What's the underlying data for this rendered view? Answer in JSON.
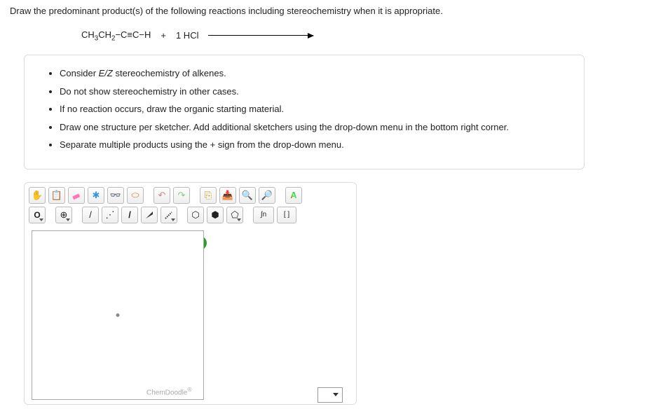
{
  "question": {
    "prompt": "Draw the predominant product(s) of the following reactions including stereochemistry when it is appropriate.",
    "reaction": {
      "reactant_html": "CH<sub>3</sub>CH<sub>2</sub>−C≡C−H",
      "plus": "+",
      "reagent": "1 HCl"
    }
  },
  "hints": [
    "Consider <span class=\"italic\">E/Z</span> stereochemistry of alkenes.",
    "Do not show stereochemistry in other cases.",
    "If no reaction occurs, draw the organic starting material.",
    "Draw one structure per sketcher. Add additional sketchers using the drop-down menu in the bottom right corner.",
    "Separate multiple products using the + sign from the drop-down menu."
  ],
  "sketcher": {
    "help_badge": "?",
    "chemdoodle_label": "ChemDoodle",
    "element_button": "O",
    "charge_button": "⊕",
    "toolbar1": {
      "hand": "✋",
      "clipboard": "📋",
      "eraser": "⌫",
      "center": "✱",
      "glasses": "👓",
      "lasso": "⬭",
      "undo": "↶",
      "redo": "↷",
      "copy": "⎘",
      "paste": "📥",
      "zoom_in": "🔍",
      "zoom_out": "🔎",
      "style": "A"
    },
    "bonds": {
      "single": "/",
      "recess": "⋰",
      "bold": "/",
      "wedge": "◢",
      "hash": "▤",
      "hex": "⬡",
      "hex2": "⬢",
      "pent": "⬠",
      "sn": "∫n",
      "bracket": "[ ]"
    }
  }
}
